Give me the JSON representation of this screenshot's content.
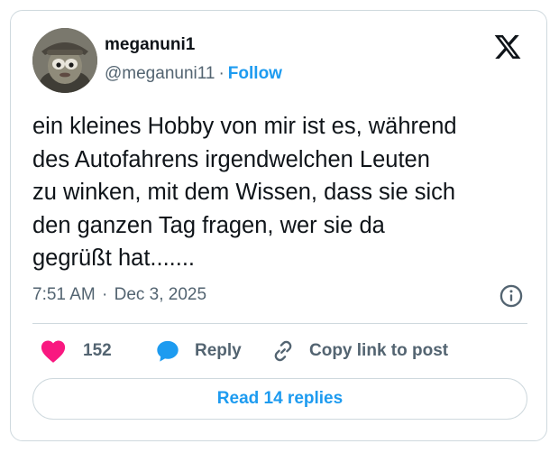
{
  "author": {
    "display_name": "meganuni1",
    "handle": "@meganuni11",
    "follow_label": "Follow"
  },
  "tweet": {
    "text": "ein kleines Hobby von mir ist es, während\ndes Autofahrens irgendwelchen Leuten\nzu winken, mit dem Wissen, dass sie sich\nden ganzen Tag fragen, wer sie da\ngegrüßt hat.......",
    "time": "7:51 AM",
    "date": "Dec 3, 2025"
  },
  "actions": {
    "like_count": "152",
    "reply_label": "Reply",
    "copy_label": "Copy link to post"
  },
  "read_replies_label": "Read 14 replies",
  "colors": {
    "accent": "#1d9bf0",
    "like": "#f91880",
    "text": "#0f1419",
    "muted": "#536471",
    "border": "#cfd9de"
  },
  "icons": {
    "brand": "x-logo-icon",
    "info": "info-icon",
    "like": "heart-icon",
    "reply": "speech-bubble-icon",
    "copy": "link-icon"
  }
}
